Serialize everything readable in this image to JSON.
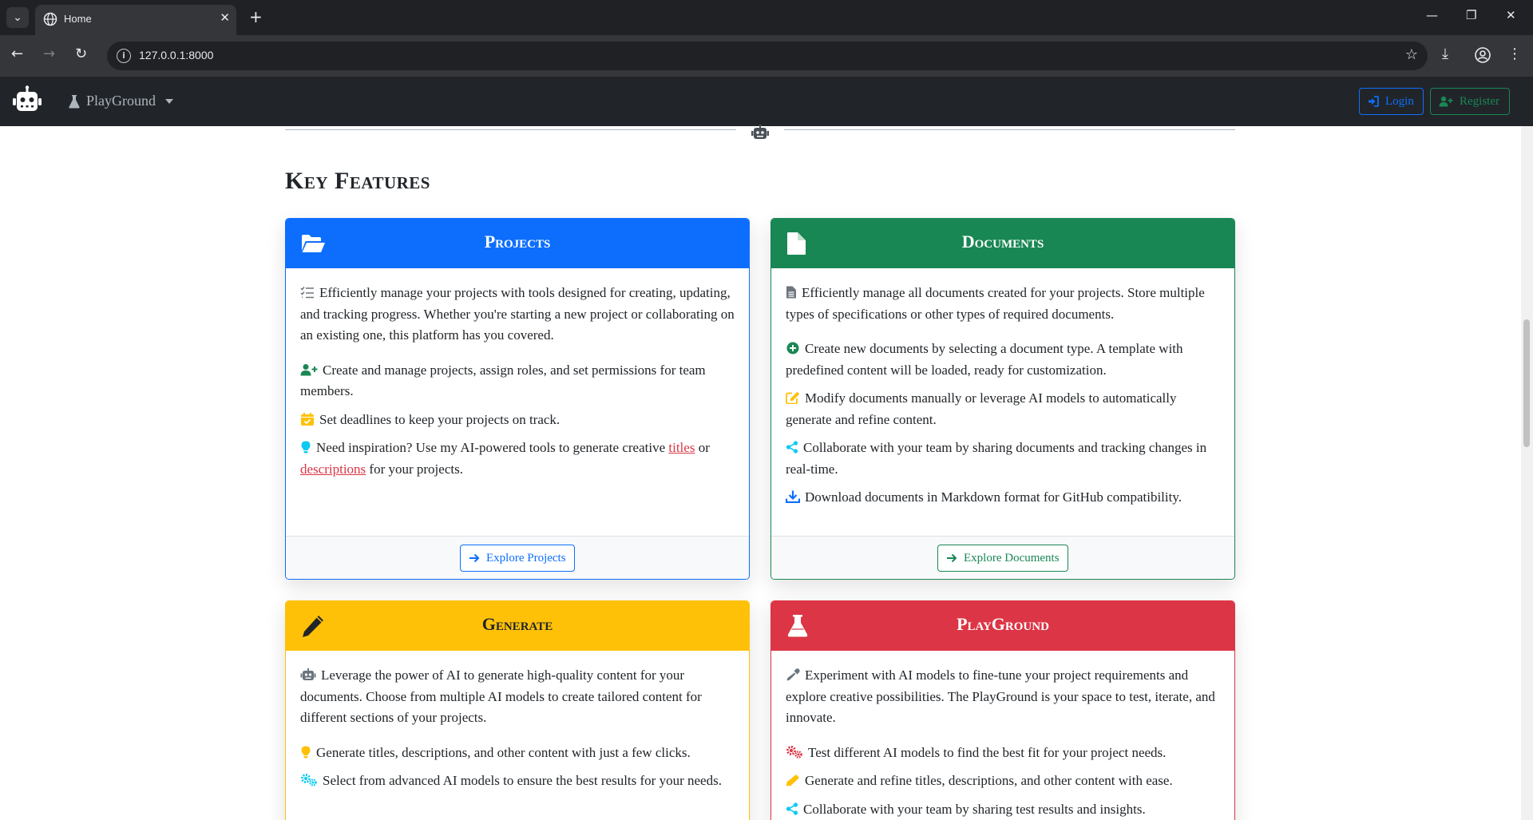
{
  "browser": {
    "tab_title": "Home",
    "tab_close": "✕",
    "new_tab": "+",
    "url": "127.0.0.1:8000",
    "minimize": "—",
    "restore": "❐",
    "close": "✕"
  },
  "navbar": {
    "brand_dropdown": "PlayGround",
    "login": "Login",
    "register": "Register"
  },
  "section": {
    "title": "Key Features"
  },
  "cards": {
    "projects": {
      "title": "Projects",
      "intro": "Efficiently manage your projects with tools designed for creating, updating, and tracking progress. Whether you're starting a new project or collaborating on an existing one, this platform has you covered.",
      "item1": "Create and manage projects, assign roles, and set permissions for team members.",
      "item2": "Set deadlines to keep your projects on track.",
      "item3_pre": "Need inspiration? Use my AI-powered tools to generate creative ",
      "item3_link1": "titles",
      "item3_mid": " or ",
      "item3_link2": "descriptions",
      "item3_post": " for your projects.",
      "button": "Explore Projects"
    },
    "documents": {
      "title": "Documents",
      "intro": "Efficiently manage all documents created for your projects. Store multiple types of specifications or other types of required documents.",
      "item1": "Create new documents by selecting a document type. A template with predefined content will be loaded, ready for customization.",
      "item2": "Modify documents manually or leverage AI models to automatically generate and refine content.",
      "item3": "Collaborate with your team by sharing documents and tracking changes in real-time.",
      "item4": "Download documents in Markdown format for GitHub compatibility.",
      "button": "Explore Documents"
    },
    "generate": {
      "title": "Generate",
      "intro": "Leverage the power of AI to generate high-quality content for your documents. Choose from multiple AI models to create tailored content for different sections of your projects.",
      "item1": "Generate titles, descriptions, and other content with just a few clicks.",
      "item2": "Select from advanced AI models to ensure the best results for your needs."
    },
    "playground": {
      "title": "PlayGround",
      "intro": "Experiment with AI models to fine-tune your project requirements and explore creative possibilities. The PlayGround is your space to test, iterate, and innovate.",
      "item1": "Test different AI models to find the best fit for your project needs.",
      "item2": "Generate and refine titles, descriptions, and other content with ease.",
      "item3": "Collaborate with your team by sharing test results and insights."
    }
  },
  "colors": {
    "primary": "#0d6efd",
    "success": "#198754",
    "warning": "#ffc107",
    "danger": "#dc3545",
    "dark": "#212529"
  }
}
